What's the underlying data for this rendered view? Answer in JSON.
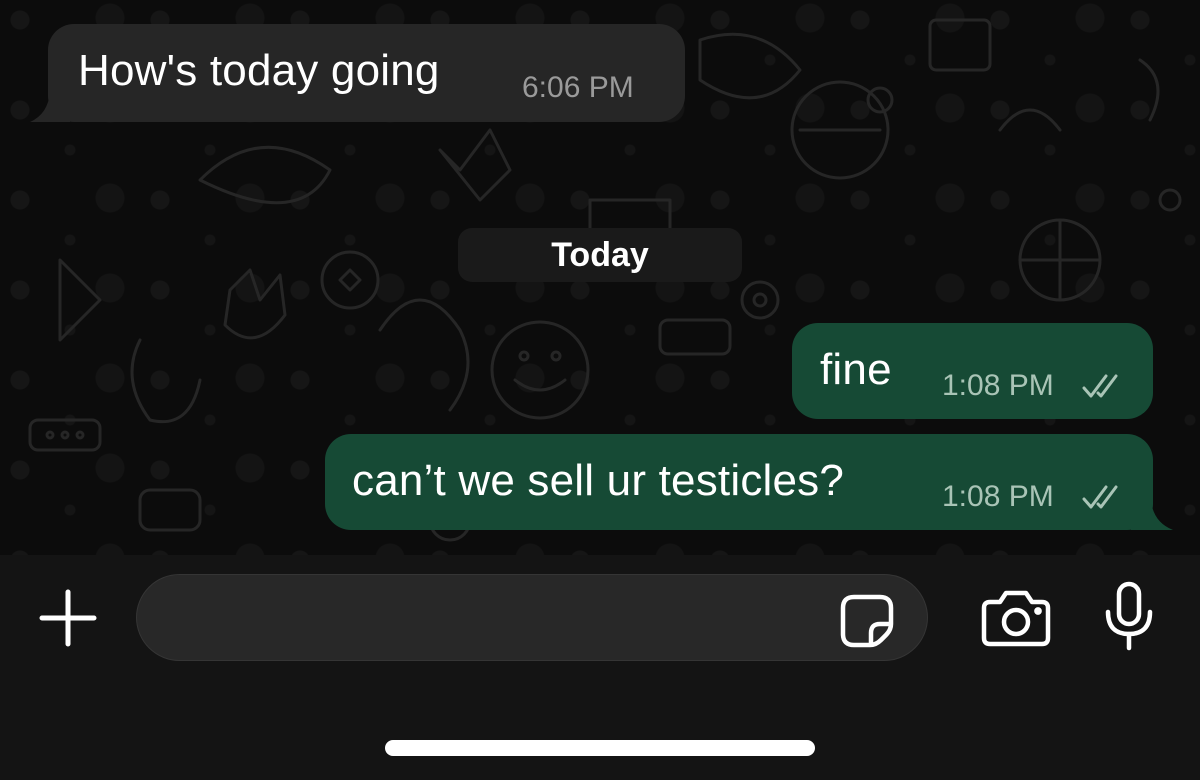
{
  "chat": {
    "messages": [
      {
        "direction": "incoming",
        "text": "How's today going",
        "time": "6:06 PM"
      },
      {
        "direction": "outgoing",
        "text": "fine",
        "time": "1:08 PM",
        "status_icon": "double-check-icon"
      },
      {
        "direction": "outgoing",
        "text": "can’t we sell ur testicles?",
        "time": "1:08 PM",
        "status_icon": "double-check-icon"
      }
    ],
    "date_separator": "Today"
  },
  "composer": {
    "input_value": "",
    "icons": {
      "add": "plus-icon",
      "sticker": "sticker-icon",
      "camera": "camera-icon",
      "mic": "microphone-icon"
    }
  },
  "colors": {
    "incoming_bubble": "#262626",
    "outgoing_bubble": "#164a35",
    "background": "#0c0c0c",
    "composer_bar": "#141414"
  }
}
